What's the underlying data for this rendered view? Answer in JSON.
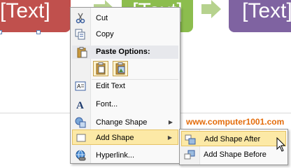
{
  "slide": {
    "shape_text_1": "[Text]",
    "shape_text_2": "[Text]",
    "shape_text_3": "[Text]",
    "watermark": "www.computer1001.com"
  },
  "menu": {
    "cut": "Cut",
    "copy": "Copy",
    "paste_options": "Paste Options:",
    "edit_text": "Edit Text",
    "font": "Font...",
    "change_shape": "Change Shape",
    "add_shape": "Add Shape",
    "hyperlink": "Hyperlink..."
  },
  "submenu": {
    "add_shape_after": "Add Shape After",
    "add_shape_before": "Add Shape Before"
  },
  "colors": {
    "shape_red": "#c0504d",
    "shape_green": "#8cbd4e",
    "shape_purple": "#7f63a1",
    "arrow": "#b6d28e",
    "highlight": "#fce9a6",
    "watermark": "#e46c0a"
  }
}
